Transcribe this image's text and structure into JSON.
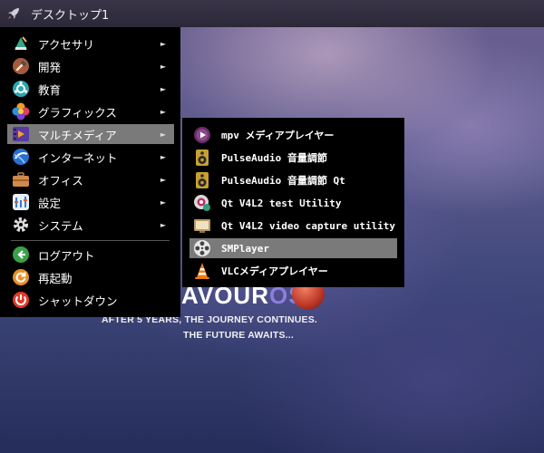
{
  "panel": {
    "title": "デスクトップ1",
    "launcher_icon": "rocket-icon"
  },
  "wallpaper": {
    "logo_main": "AVOUR",
    "logo_accent": "OS",
    "line1": "AFTER 5 YEARS, THE JOURNEY CONTINUES.",
    "line2": "THE FUTURE AWAITS..."
  },
  "menu": {
    "arrow": "►",
    "items": [
      {
        "label": "アクセサリ",
        "icon": "accessories-icon",
        "submenu": true
      },
      {
        "label": "開発",
        "icon": "development-icon",
        "submenu": true
      },
      {
        "label": "教育",
        "icon": "education-icon",
        "submenu": true
      },
      {
        "label": "グラフィックス",
        "icon": "graphics-icon",
        "submenu": true
      },
      {
        "label": "マルチメディア",
        "icon": "multimedia-icon",
        "submenu": true,
        "active": true
      },
      {
        "label": "インターネット",
        "icon": "internet-icon",
        "submenu": true
      },
      {
        "label": "オフィス",
        "icon": "office-icon",
        "submenu": true
      },
      {
        "label": "設定",
        "icon": "settings-icon",
        "submenu": true
      },
      {
        "label": "システム",
        "icon": "system-icon",
        "submenu": true
      }
    ],
    "session": [
      {
        "label": "ログアウト",
        "icon": "logout-icon"
      },
      {
        "label": "再起動",
        "icon": "reboot-icon"
      },
      {
        "label": "シャットダウン",
        "icon": "shutdown-icon"
      }
    ]
  },
  "submenu": {
    "items": [
      {
        "label": "mpv メディアプレイヤー",
        "icon": "mpv-icon"
      },
      {
        "label": "PulseAudio 音量調節",
        "icon": "speaker-icon"
      },
      {
        "label": "PulseAudio 音量調節 Qt",
        "icon": "speaker-icon"
      },
      {
        "label": "Qt V4L2 test Utility",
        "icon": "webcam-icon"
      },
      {
        "label": "Qt V4L2 video capture utility",
        "icon": "video-capture-icon"
      },
      {
        "label": "SMPlayer",
        "icon": "film-reel-icon",
        "active": true
      },
      {
        "label": "VLCメディアプレイヤー",
        "icon": "vlc-cone-icon"
      }
    ]
  }
}
